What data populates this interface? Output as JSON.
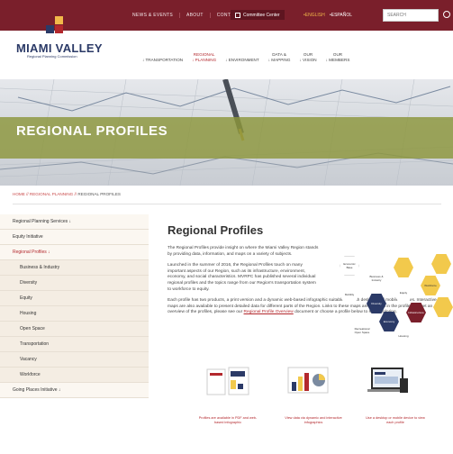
{
  "topbar": {
    "links": [
      "NEWS & EVENTS",
      "ABOUT",
      "CONTACT"
    ],
    "committee_center": "Committee Center",
    "lang_english": "•ENGLISH",
    "lang_espanol": "•ESPAÑOL",
    "search_placeholder": "SEARCH"
  },
  "brand": {
    "title": "MIAMI VALLEY",
    "subtitle": "Regional Planning Commission",
    "logo_colors": [
      "#7a1f2b",
      "#f2b94a",
      "#2b3a67",
      "#b3282d"
    ]
  },
  "nav": [
    {
      "l1": "",
      "l2": "↓ TRANSPORTATION"
    },
    {
      "l1": "REGIONAL",
      "l2": "↓ PLANNING",
      "active": true
    },
    {
      "l1": "",
      "l2": "↓ ENVIRONMENT"
    },
    {
      "l1": "DATA &",
      "l2": "↓ MAPPING"
    },
    {
      "l1": "OUR",
      "l2": "↓ VISION"
    },
    {
      "l1": "OUR",
      "l2": "↓ MEMBERS"
    }
  ],
  "banner": {
    "title": "REGIONAL PROFILES"
  },
  "breadcrumb": {
    "home": "HOME",
    "sep": "//",
    "parent": "REGIONAL PLANNING",
    "current": "REGIONAL PROFILES"
  },
  "sidebar": [
    {
      "label": "Regional Planning Services ↓",
      "sub": false
    },
    {
      "label": "Equity Initiative",
      "sub": false
    },
    {
      "label": "Regional Profiles ↓",
      "sub": false,
      "active": true
    },
    {
      "label": "Business & Industry",
      "sub": true
    },
    {
      "label": "Diversity",
      "sub": true
    },
    {
      "label": "Equity",
      "sub": true
    },
    {
      "label": "Housing",
      "sub": true
    },
    {
      "label": "Open Space",
      "sub": true
    },
    {
      "label": "Transportation",
      "sub": true
    },
    {
      "label": "Vacancy",
      "sub": true
    },
    {
      "label": "Workforce",
      "sub": true
    },
    {
      "label": "Going Places Initiative ↓",
      "sub": false
    }
  ],
  "main": {
    "heading": "Regional Profiles",
    "p1": "The Regional Profiles provide insight on where the Miami Valley Region stands by providing data, information, and maps on a variety of subjects.",
    "p2": "Launched in the summer of 2016, the Regional Profiles touch on many important aspects of our Region, such as its infrastructure, environment, economy, and social characteristics. MVRPC has published several individual regional profiles and the topics range from our Region's transportation system to workforce to equity.",
    "p3a": "Each profile has two products, a print version and a dynamic web-based infographic suitable for both desktop and mobile devices. Interactive web maps are also available to present detailed data for different parts of the Region. Links to these maps are included in the profiles. To get an overview of the profiles, please see our ",
    "p3_link": "Regional Profile Overview",
    "p3b": " document or choose a profile below to start exploring."
  },
  "hexes": [
    "Economic Base",
    "Business & Industry",
    "",
    "Mobility",
    "Diversity",
    "Equity",
    "Economy",
    "Infrastructure",
    "Workforce",
    "Recreational Open Space",
    "Housing",
    "",
    "",
    ""
  ],
  "captions": [
    "Profiles are available in PDF and web-based infographic",
    "View data via dynamic and interactive infographics",
    "Use a desktop or mobile device to view each profile"
  ]
}
